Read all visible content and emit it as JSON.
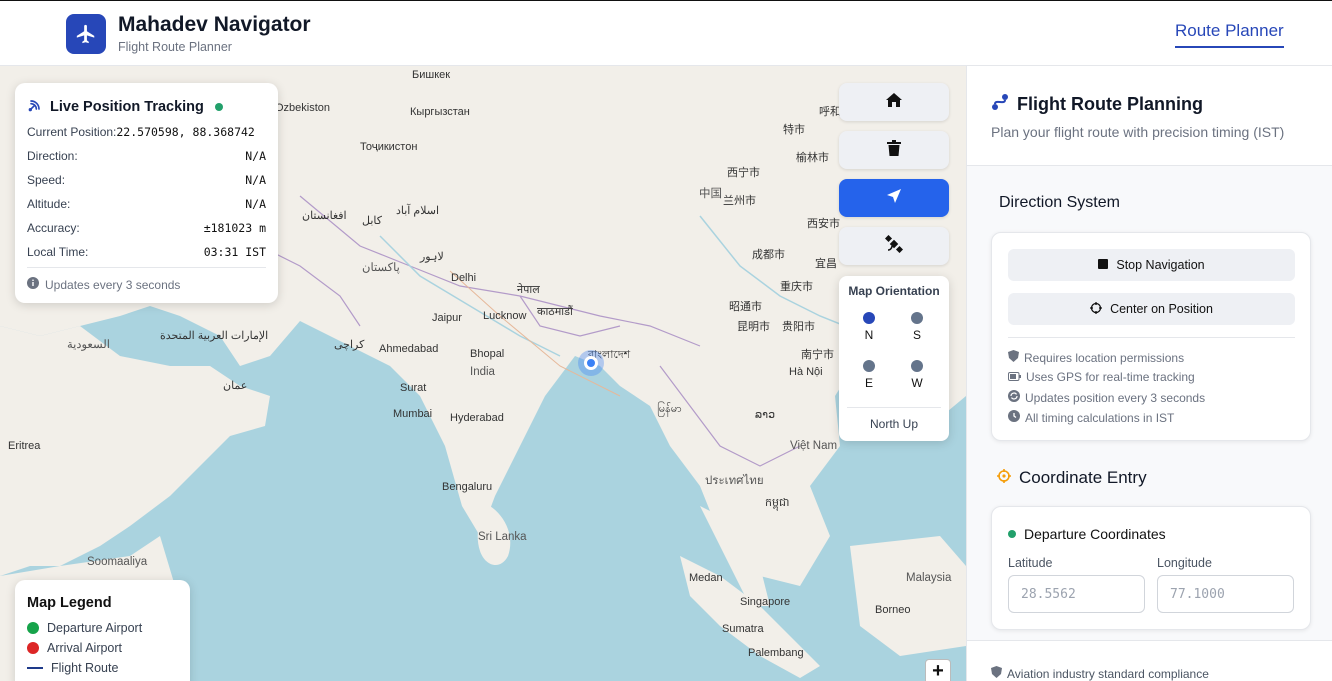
{
  "header": {
    "app_title": "Mahadev Navigator",
    "app_subtitle": "Flight Route Planner",
    "nav_link": "Route Planner"
  },
  "map": {
    "places": [
      {
        "name": "Бишкек"
      },
      {
        "name": "Кыргызстан"
      },
      {
        "name": "Ozbekiston"
      },
      {
        "name": "Тоҷикистон"
      },
      {
        "name": "اسلام آباد"
      },
      {
        "name": "کابل"
      },
      {
        "name": "افغانستان"
      },
      {
        "name": "لاہور"
      },
      {
        "name": "پاکستان"
      },
      {
        "name": "Delhi"
      },
      {
        "name": "नेपाल"
      },
      {
        "name": "काठमाडौं"
      },
      {
        "name": "Jaipur"
      },
      {
        "name": "Lucknow"
      },
      {
        "name": "کراچی"
      },
      {
        "name": "Ahmedabad"
      },
      {
        "name": "Bhopal"
      },
      {
        "name": "India"
      },
      {
        "name": "Surat"
      },
      {
        "name": "Mumbai"
      },
      {
        "name": "Hyderabad"
      },
      {
        "name": "Bengaluru"
      },
      {
        "name": "Sri Lanka"
      },
      {
        "name": "中国"
      },
      {
        "name": "西宁市"
      },
      {
        "name": "兰州市"
      },
      {
        "name": "西安市"
      },
      {
        "name": "成都市"
      },
      {
        "name": "重庆市"
      },
      {
        "name": "昭通市"
      },
      {
        "name": "昆明市"
      },
      {
        "name": "贵阳市"
      },
      {
        "name": "南宁市"
      },
      {
        "name": "Hà Nội"
      },
      {
        "name": "Việt Nam"
      },
      {
        "name": "ประเทศไทย"
      },
      {
        "name": "Malaysia"
      },
      {
        "name": "Singapore"
      },
      {
        "name": "Medan"
      },
      {
        "name": "Sumatra"
      },
      {
        "name": "Palembang"
      },
      {
        "name": "Borneo"
      },
      {
        "name": "Eritrea"
      },
      {
        "name": "السعودية"
      },
      {
        "name": "الإمارات العربية المتحدة"
      },
      {
        "name": "عمان"
      },
      {
        "name": "Soomaaliya"
      },
      {
        "name": "呼和"
      },
      {
        "name": "榆林市"
      },
      {
        "name": "特市"
      },
      {
        "name": "宜昌"
      },
      {
        "name": "বাংলাদেশ"
      },
      {
        "name": "မြန်မာ"
      },
      {
        "name": "ລາວ"
      },
      {
        "name": "កម្ពុជា"
      }
    ]
  },
  "tracking": {
    "title": "Live Position Tracking",
    "position_label": "Current Position:",
    "position_value": "22.570598, 88.368742",
    "direction_label": "Direction:",
    "direction_value": "N/A",
    "speed_label": "Speed:",
    "speed_value": "N/A",
    "altitude_label": "Altitude:",
    "altitude_value": "N/A",
    "accuracy_label": "Accuracy:",
    "accuracy_value": "±181023 m",
    "time_label": "Local Time:",
    "time_value": "03:31 IST",
    "footer": "Updates every 3 seconds"
  },
  "legend": {
    "title": "Map Legend",
    "items": [
      {
        "label": "Departure Airport",
        "color": "#16a34a"
      },
      {
        "label": "Arrival Airport",
        "color": "#dc2626"
      },
      {
        "label": "Flight Route",
        "color": "#1e3a8a"
      }
    ]
  },
  "controls": {
    "buttons": [
      {
        "icon": "home-icon"
      },
      {
        "icon": "trash-icon"
      },
      {
        "icon": "navigation-arrow-icon",
        "active": true
      },
      {
        "icon": "satellite-icon"
      }
    ],
    "orientation": {
      "title": "Map Orientation",
      "options": [
        "N",
        "S",
        "E",
        "W"
      ],
      "current": "North Up"
    },
    "zoom_in": "+"
  },
  "sidebar": {
    "title": "Flight Route Planning",
    "subtitle": "Plan your flight route with precision timing (IST)",
    "direction_system": {
      "title": "Direction System",
      "stop_button": "Stop Navigation",
      "center_button": "Center on Position",
      "notes": [
        "Requires location permissions",
        "Uses GPS for real-time tracking",
        "Updates position every 3 seconds",
        "All timing calculations in IST"
      ]
    },
    "coordinate_entry": {
      "title": "Coordinate Entry",
      "departure_title": "Departure Coordinates",
      "latitude_label": "Latitude",
      "latitude_placeholder": "28.5562",
      "longitude_label": "Longitude",
      "longitude_placeholder": "77.1000"
    },
    "compliance": "Aviation industry standard compliance"
  },
  "colors": {
    "brand": "#2747b8",
    "active_button": "#2563eb",
    "live_dot": "#22a06b",
    "water": "#aad3df",
    "land": "#f2efe9"
  }
}
